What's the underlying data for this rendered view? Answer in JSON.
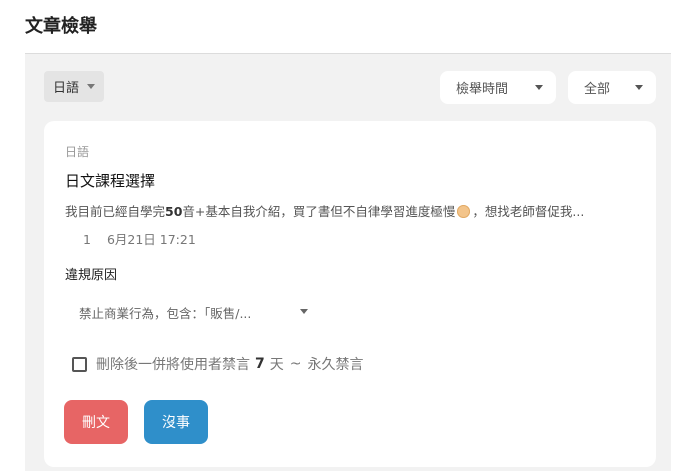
{
  "header": {
    "title": "文章檢舉"
  },
  "toolbar": {
    "language_button": "日語",
    "sort_select": "檢舉時間",
    "status_select": "全部"
  },
  "post": {
    "category": "日語",
    "title": "日文課程選擇",
    "body_start": "我目前已經自學完",
    "body_bold": "50",
    "body_mid": "音+基本自我介紹，買了書但不自律學習進度極慢",
    "body_end": "，想找老師督促我...",
    "emoji_icon": "face-emoji",
    "meta": {
      "count": "1",
      "datetime": "6月21日 17:21"
    }
  },
  "violation": {
    "label": "違規原因",
    "selected_reason": "禁止商業行為，包含：「販售/..."
  },
  "ban_option": {
    "text_before": "刪除後一併將使用者禁言",
    "days_value": "7",
    "unit": "天",
    "tilde": "~",
    "text_after": "永久禁言",
    "checked": false
  },
  "actions": {
    "delete": "刪文",
    "ignore": "沒事"
  },
  "colors": {
    "delete": "#e76565",
    "ignore": "#2f8fca",
    "panel": "#f2f2f2"
  }
}
